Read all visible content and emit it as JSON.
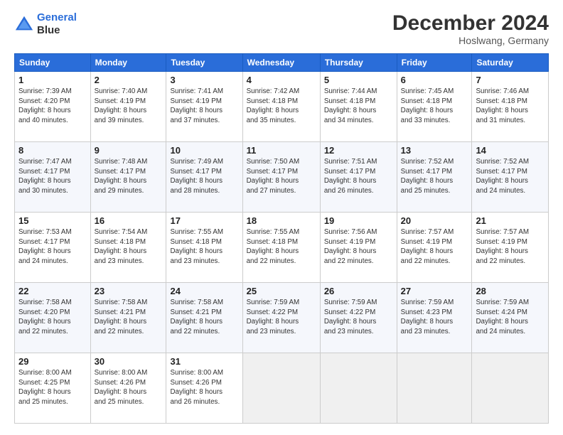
{
  "header": {
    "logo_line1": "General",
    "logo_line2": "Blue",
    "title": "December 2024",
    "subtitle": "Hoslwang, Germany"
  },
  "columns": [
    "Sunday",
    "Monday",
    "Tuesday",
    "Wednesday",
    "Thursday",
    "Friday",
    "Saturday"
  ],
  "weeks": [
    [
      {
        "day": "1",
        "sunrise": "7:39 AM",
        "sunset": "4:20 PM",
        "daylight": "8 hours and 40 minutes."
      },
      {
        "day": "2",
        "sunrise": "7:40 AM",
        "sunset": "4:19 PM",
        "daylight": "8 hours and 39 minutes."
      },
      {
        "day": "3",
        "sunrise": "7:41 AM",
        "sunset": "4:19 PM",
        "daylight": "8 hours and 37 minutes."
      },
      {
        "day": "4",
        "sunrise": "7:42 AM",
        "sunset": "4:18 PM",
        "daylight": "8 hours and 35 minutes."
      },
      {
        "day": "5",
        "sunrise": "7:44 AM",
        "sunset": "4:18 PM",
        "daylight": "8 hours and 34 minutes."
      },
      {
        "day": "6",
        "sunrise": "7:45 AM",
        "sunset": "4:18 PM",
        "daylight": "8 hours and 33 minutes."
      },
      {
        "day": "7",
        "sunrise": "7:46 AM",
        "sunset": "4:18 PM",
        "daylight": "8 hours and 31 minutes."
      }
    ],
    [
      {
        "day": "8",
        "sunrise": "7:47 AM",
        "sunset": "4:17 PM",
        "daylight": "8 hours and 30 minutes."
      },
      {
        "day": "9",
        "sunrise": "7:48 AM",
        "sunset": "4:17 PM",
        "daylight": "8 hours and 29 minutes."
      },
      {
        "day": "10",
        "sunrise": "7:49 AM",
        "sunset": "4:17 PM",
        "daylight": "8 hours and 28 minutes."
      },
      {
        "day": "11",
        "sunrise": "7:50 AM",
        "sunset": "4:17 PM",
        "daylight": "8 hours and 27 minutes."
      },
      {
        "day": "12",
        "sunrise": "7:51 AM",
        "sunset": "4:17 PM",
        "daylight": "8 hours and 26 minutes."
      },
      {
        "day": "13",
        "sunrise": "7:52 AM",
        "sunset": "4:17 PM",
        "daylight": "8 hours and 25 minutes."
      },
      {
        "day": "14",
        "sunrise": "7:52 AM",
        "sunset": "4:17 PM",
        "daylight": "8 hours and 24 minutes."
      }
    ],
    [
      {
        "day": "15",
        "sunrise": "7:53 AM",
        "sunset": "4:17 PM",
        "daylight": "8 hours and 24 minutes."
      },
      {
        "day": "16",
        "sunrise": "7:54 AM",
        "sunset": "4:18 PM",
        "daylight": "8 hours and 23 minutes."
      },
      {
        "day": "17",
        "sunrise": "7:55 AM",
        "sunset": "4:18 PM",
        "daylight": "8 hours and 23 minutes."
      },
      {
        "day": "18",
        "sunrise": "7:55 AM",
        "sunset": "4:18 PM",
        "daylight": "8 hours and 22 minutes."
      },
      {
        "day": "19",
        "sunrise": "7:56 AM",
        "sunset": "4:19 PM",
        "daylight": "8 hours and 22 minutes."
      },
      {
        "day": "20",
        "sunrise": "7:57 AM",
        "sunset": "4:19 PM",
        "daylight": "8 hours and 22 minutes."
      },
      {
        "day": "21",
        "sunrise": "7:57 AM",
        "sunset": "4:19 PM",
        "daylight": "8 hours and 22 minutes."
      }
    ],
    [
      {
        "day": "22",
        "sunrise": "7:58 AM",
        "sunset": "4:20 PM",
        "daylight": "8 hours and 22 minutes."
      },
      {
        "day": "23",
        "sunrise": "7:58 AM",
        "sunset": "4:21 PM",
        "daylight": "8 hours and 22 minutes."
      },
      {
        "day": "24",
        "sunrise": "7:58 AM",
        "sunset": "4:21 PM",
        "daylight": "8 hours and 22 minutes."
      },
      {
        "day": "25",
        "sunrise": "7:59 AM",
        "sunset": "4:22 PM",
        "daylight": "8 hours and 23 minutes."
      },
      {
        "day": "26",
        "sunrise": "7:59 AM",
        "sunset": "4:22 PM",
        "daylight": "8 hours and 23 minutes."
      },
      {
        "day": "27",
        "sunrise": "7:59 AM",
        "sunset": "4:23 PM",
        "daylight": "8 hours and 23 minutes."
      },
      {
        "day": "28",
        "sunrise": "7:59 AM",
        "sunset": "4:24 PM",
        "daylight": "8 hours and 24 minutes."
      }
    ],
    [
      {
        "day": "29",
        "sunrise": "8:00 AM",
        "sunset": "4:25 PM",
        "daylight": "8 hours and 25 minutes."
      },
      {
        "day": "30",
        "sunrise": "8:00 AM",
        "sunset": "4:26 PM",
        "daylight": "8 hours and 25 minutes."
      },
      {
        "day": "31",
        "sunrise": "8:00 AM",
        "sunset": "4:26 PM",
        "daylight": "8 hours and 26 minutes."
      },
      null,
      null,
      null,
      null
    ]
  ]
}
